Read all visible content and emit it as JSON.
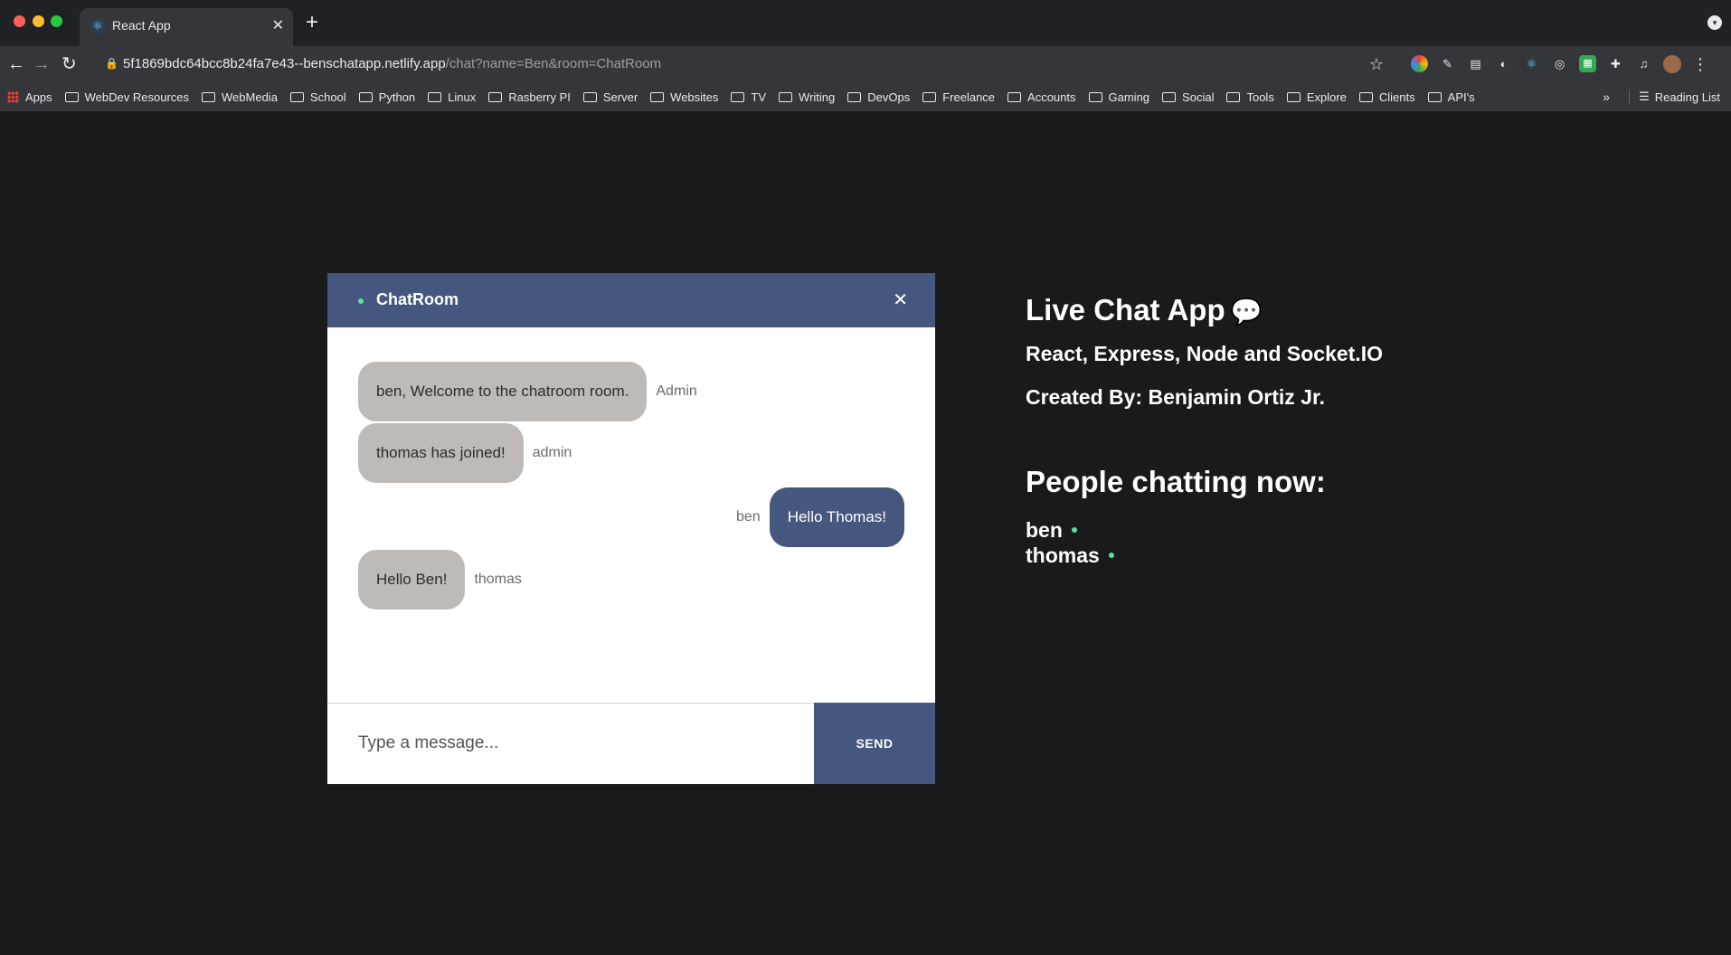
{
  "browser": {
    "tab_title": "React App",
    "url_host": "5f1869bdc64bcc8b24fa7e43--benschatapp.netlify.app",
    "url_path": "/chat?name=Ben&room=ChatRoom",
    "bookmarks": [
      "Apps",
      "WebDev Resources",
      "WebMedia",
      "School",
      "Python",
      "Linux",
      "Rasberry PI",
      "Server",
      "Websites",
      "TV",
      "Writing",
      "DevOps",
      "Freelance",
      "Accounts",
      "Gaming",
      "Social",
      "Tools",
      "Explore",
      "Clients",
      "API's"
    ],
    "reading_list": "Reading List"
  },
  "chat": {
    "room_name": "ChatRoom",
    "messages": [
      {
        "text": "ben, Welcome to the chatroom room.",
        "sender": "Admin",
        "mine": false
      },
      {
        "text": "thomas has joined!",
        "sender": "admin",
        "mine": false
      },
      {
        "text": "Hello Thomas!",
        "sender": "ben",
        "mine": true
      },
      {
        "text": "Hello Ben!",
        "sender": "thomas",
        "mine": false
      }
    ],
    "input_placeholder": "Type a message...",
    "send_label": "SEND"
  },
  "info": {
    "title": "Live Chat App",
    "tech": "React, Express, Node and Socket.IO",
    "credits": "Created By: Benjamin Ortiz Jr.",
    "people_title": "People chatting now:",
    "people": [
      "ben",
      "thomas"
    ]
  },
  "colors": {
    "accent": "#45567f",
    "online": "#56e39f",
    "bubble_other": "#bdbab8",
    "page_bg": "#1a1a1d"
  }
}
